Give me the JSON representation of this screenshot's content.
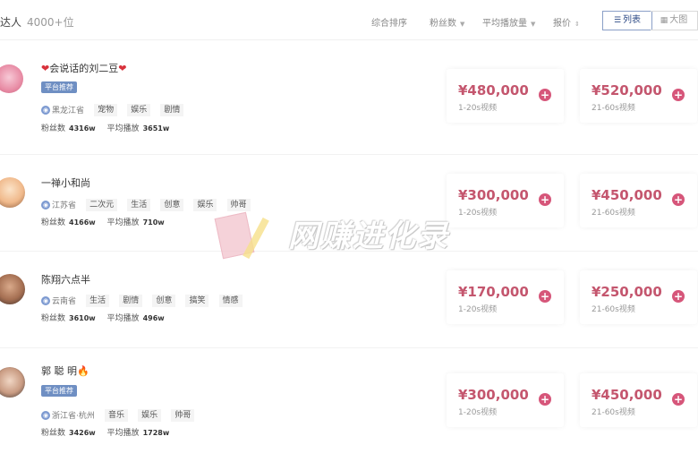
{
  "header": {
    "title": "达人",
    "count": "4000+位",
    "sorts": [
      {
        "label": "综合排序",
        "arrow": ""
      },
      {
        "label": "粉丝数",
        "arrow": "▼"
      },
      {
        "label": "平均播放量",
        "arrow": "▼"
      },
      {
        "label": "报价",
        "arrow": "⇕"
      }
    ],
    "view_list": "列表",
    "view_big": "大图"
  },
  "colors": {
    "accent": "#c4566e",
    "plus": "#d6567a",
    "badge": "#6f8fc3"
  },
  "creators": [
    {
      "name": "会说话的刘二豆",
      "name_prefix_icon": "heart-icon",
      "name_suffix_icon": "heart-icon",
      "badge": "平台推荐",
      "location": "黑龙江省",
      "tags": [
        "宠物",
        "娱乐",
        "剧情"
      ],
      "fans_label": "粉丝数",
      "fans": "4316w",
      "plays_label": "平均播放",
      "plays": "3651w",
      "prices": [
        {
          "price": "¥480,000",
          "duration": "1-20s视频"
        },
        {
          "price": "¥520,000",
          "duration": "21-60s视频"
        }
      ]
    },
    {
      "name": "一禅小和尚",
      "location": "江苏省",
      "tags": [
        "二次元",
        "生活",
        "创意",
        "娱乐",
        "帅哥"
      ],
      "fans_label": "粉丝数",
      "fans": "4166w",
      "plays_label": "平均播放",
      "plays": "710w",
      "prices": [
        {
          "price": "¥300,000",
          "duration": "1-20s视频"
        },
        {
          "price": "¥450,000",
          "duration": "21-60s视频"
        }
      ]
    },
    {
      "name": "陈翔六点半",
      "location": "云南省",
      "tags": [
        "生活",
        "剧情",
        "创意",
        "搞笑",
        "情感"
      ],
      "fans_label": "粉丝数",
      "fans": "3610w",
      "plays_label": "平均播放",
      "plays": "496w",
      "prices": [
        {
          "price": "¥170,000",
          "duration": "1-20s视频"
        },
        {
          "price": "¥250,000",
          "duration": "21-60s视频"
        }
      ]
    },
    {
      "name": "郭 聪 明",
      "name_suffix_icon": "fire-icon",
      "badge": "平台推荐",
      "location": "浙江省·杭州",
      "tags": [
        "音乐",
        "娱乐",
        "帅哥"
      ],
      "fans_label": "粉丝数",
      "fans": "3426w",
      "plays_label": "平均播放",
      "plays": "1728w",
      "prices": [
        {
          "price": "¥300,000",
          "duration": "1-20s视频"
        },
        {
          "price": "¥450,000",
          "duration": "21-60s视频"
        }
      ]
    }
  ],
  "watermark": "网赚进化录"
}
